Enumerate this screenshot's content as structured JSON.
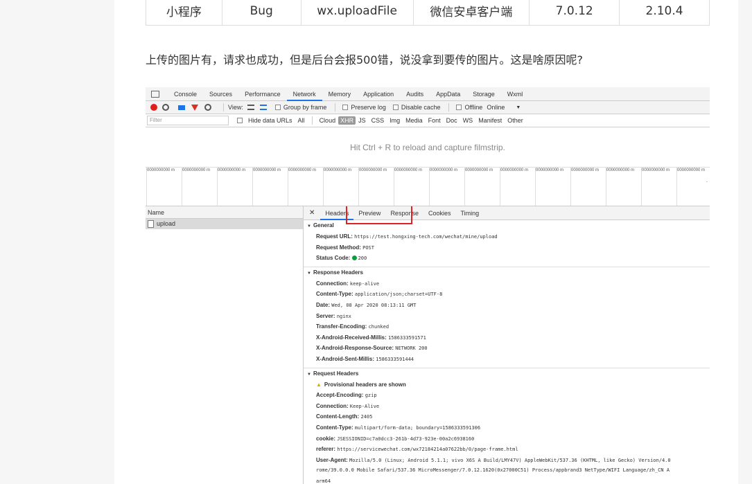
{
  "table_row": [
    "小程序",
    "Bug",
    "wx.uploadFile",
    "微信安卓客户端",
    "7.0.12",
    "2.10.4"
  ],
  "question": "上传的图片有，请求也成功，但是后台会报500错，说没拿到要传的图片。这是啥原因呢?",
  "devtools": {
    "tabs": [
      "Console",
      "Sources",
      "Performance",
      "Network",
      "Memory",
      "Application",
      "Audits",
      "AppData",
      "Storage",
      "Wxml"
    ],
    "active_tab": "Network",
    "toolbar": {
      "view_label": "View:",
      "group_by_frame": "Group by frame",
      "preserve_log": "Preserve log",
      "disable_cache": "Disable cache",
      "offline": "Offline",
      "throttle": "Online"
    },
    "filter": {
      "placeholder": "Filter",
      "hide_data_urls": "Hide data URLs",
      "types": [
        "All",
        "Cloud",
        "XHR",
        "JS",
        "CSS",
        "Img",
        "Media",
        "Font",
        "Doc",
        "WS",
        "Manifest",
        "Other"
      ],
      "selected_type": "XHR"
    },
    "filmstrip_hint": "Hit Ctrl + R to reload and capture filmstrip.",
    "overview_labels": [
      "0000000000 m",
      "0000000000 m",
      "0000000000 m",
      "0000000000 m",
      "0000000000 m",
      "0000000000 m",
      "0000000000 m",
      "0000000000 m",
      "0000000000 m",
      "0000000000 m",
      "0000000000 m",
      "0000000000 m",
      "0000000000 m",
      "0000000000 m",
      "0000000000 m",
      "0000000000 m"
    ],
    "name_header": "Name",
    "requests": [
      "upload"
    ],
    "detail_tabs": [
      "Headers",
      "Preview",
      "Response",
      "Cookies",
      "Timing"
    ],
    "active_detail_tab": "Headers",
    "general": {
      "title": "General",
      "request_url_key": "Request URL:",
      "request_url": "https://test.hongxing-tech.com/wechat/mine/upload",
      "request_method_key": "Request Method:",
      "request_method": "POST",
      "status_code_key": "Status Code:",
      "status_code": "200"
    },
    "response_headers": {
      "title": "Response Headers",
      "items": [
        {
          "k": "Connection:",
          "v": "keep-alive"
        },
        {
          "k": "Content-Type:",
          "v": "application/json;charset=UTF-8"
        },
        {
          "k": "Date:",
          "v": "Wed, 08 Apr 2020 08:13:11 GMT"
        },
        {
          "k": "Server:",
          "v": "nginx"
        },
        {
          "k": "Transfer-Encoding:",
          "v": "chunked"
        },
        {
          "k": "X-Android-Received-Millis:",
          "v": "1586333591571"
        },
        {
          "k": "X-Android-Response-Source:",
          "v": "NETWORK 200"
        },
        {
          "k": "X-Android-Sent-Millis:",
          "v": "1586333591444"
        }
      ]
    },
    "request_headers": {
      "title": "Request Headers",
      "provisional": "Provisional headers are shown",
      "items": [
        {
          "k": "Accept-Encoding:",
          "v": "gzip"
        },
        {
          "k": "Connection:",
          "v": "Keep-Alive"
        },
        {
          "k": "Content-Length:",
          "v": "2405"
        },
        {
          "k": "Content-Type:",
          "v": "multipart/form-data; boundary=1586333591306"
        },
        {
          "k": "cookie:",
          "v": "JSESSIONID=c7a0dcc3-261b-4d73-923e-00a2c6938160"
        },
        {
          "k": "referer:",
          "v": "https://servicewechat.com/wx72184214a07622bb/0/page-frame.html"
        },
        {
          "k": "User-Agent:",
          "v": "Mozilla/5.0 (Linux; Android 5.1.1; vivo X6S A Build/LMY47V) AppleWebKit/537.36 (KHTML, like Gecko) Version/4.0"
        }
      ],
      "ua_continuation": "rome/39.0.0.0 Mobile Safari/537.36 MicroMessenger/7.0.12.1620(0x27000C51) Process/appbrand3 NetType/WIFI Language/zh_CN A",
      "ua_continuation2": "arm64"
    }
  }
}
